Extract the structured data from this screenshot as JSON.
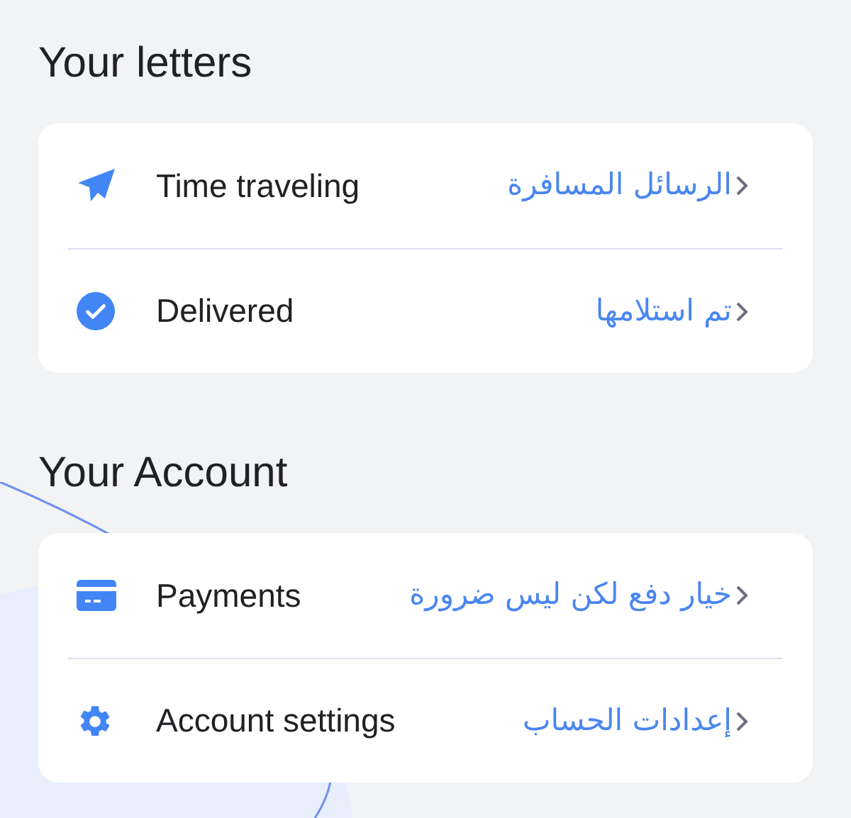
{
  "sections": [
    {
      "title": "Your letters",
      "items": [
        {
          "kind": "send",
          "label": "Time traveling",
          "value": "الرسائل المسافرة"
        },
        {
          "kind": "check",
          "label": "Delivered",
          "value": "تم استلامها"
        }
      ]
    },
    {
      "title": "Your Account",
      "items": [
        {
          "kind": "card",
          "label": "Payments",
          "value": "خيار دفع لكن ليس ضرورة"
        },
        {
          "kind": "gear",
          "label": "Account settings",
          "value": "إعدادات الحساب"
        }
      ]
    }
  ]
}
